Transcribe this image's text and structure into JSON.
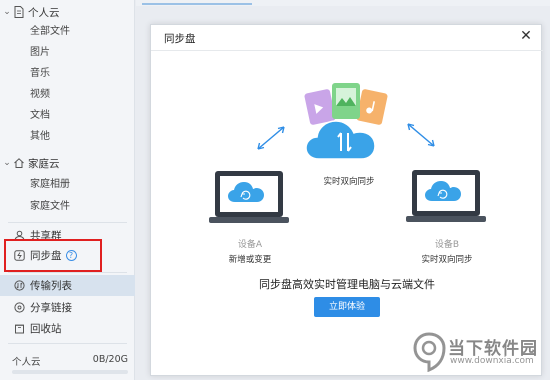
{
  "sidebar": {
    "groups": [
      {
        "label": "个人云",
        "icon": "document-icon",
        "items": [
          "全部文件",
          "图片",
          "音乐",
          "视频",
          "文档",
          "其他"
        ]
      },
      {
        "label": "家庭云",
        "icon": "home-icon",
        "items": [
          "家庭相册",
          "家庭文件"
        ]
      }
    ],
    "nav": [
      {
        "label": "共享群",
        "icon": "user-icon"
      },
      {
        "label": "同步盘",
        "icon": "sync-disk-icon",
        "badge": "?"
      },
      {
        "label": "传输列表",
        "icon": "transfer-icon",
        "active": true
      },
      {
        "label": "分享链接",
        "icon": "share-link-icon"
      },
      {
        "label": "回收站",
        "icon": "trash-icon"
      }
    ],
    "quota": {
      "label": "个人云",
      "value": "0B/20G",
      "used_fraction": 0.0
    }
  },
  "dialog": {
    "title": "同步盘",
    "close_symbol": "✕",
    "center_caption": "实时双向同步",
    "device_a": {
      "name": "设备A",
      "desc": "新增或变更"
    },
    "device_b": {
      "name": "设备B",
      "desc": "实时双向同步"
    },
    "tagline": "同步盘高效实时管理电脑与云端文件",
    "cta_label": "立即体验"
  },
  "watermark": {
    "title": "当下软件园",
    "url": "www.downxia.com"
  },
  "colors": {
    "accent": "#2e8de6",
    "cloud": "#3aa3e8",
    "highlight": "#e02020",
    "active_row": "#d7e2ee"
  }
}
